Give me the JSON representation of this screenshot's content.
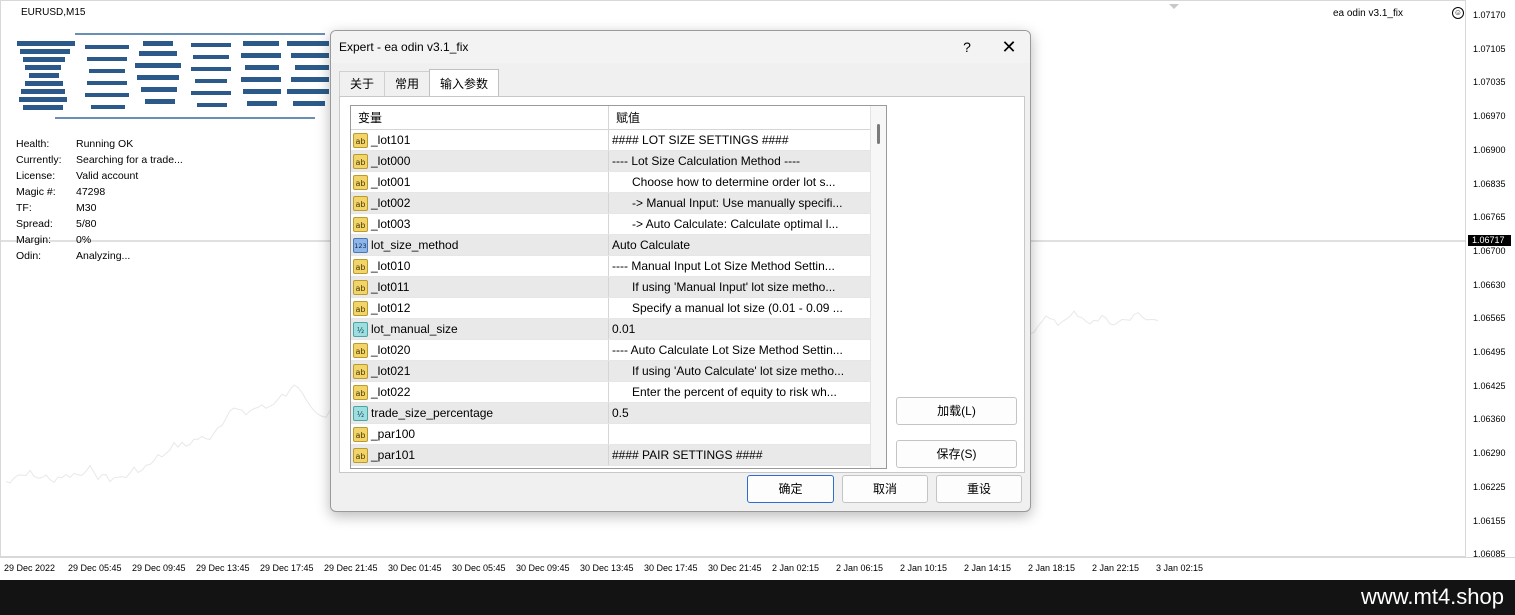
{
  "chart": {
    "symbol": "EURUSD,M15",
    "ea_label": "ea odin v3.1_fix",
    "status": [
      {
        "label": "Health:",
        "value": "Running OK"
      },
      {
        "label": "Currently:",
        "value": "Searching for a trade..."
      },
      {
        "label": "License:",
        "value": "Valid account"
      },
      {
        "label": "Magic #:",
        "value": "47298"
      },
      {
        "label": "TF:",
        "value": "M30"
      },
      {
        "label": "Spread:",
        "value": "5/80"
      },
      {
        "label": "Margin:",
        "value": "0%"
      },
      {
        "label": "Odin:",
        "value": "Analyzing..."
      }
    ],
    "price_labels": [
      "1.07170",
      "1.07105",
      "1.07035",
      "1.06970",
      "1.06900",
      "1.06835",
      "1.06765",
      "1.06700",
      "1.06630",
      "1.06565",
      "1.06495",
      "1.06425",
      "1.06360",
      "1.06290",
      "1.06225",
      "1.06155",
      "1.06085"
    ],
    "current_price": "1.06717",
    "time_labels": [
      "29 Dec 2022",
      "29 Dec 05:45",
      "29 Dec 09:45",
      "29 Dec 13:45",
      "29 Dec 17:45",
      "29 Dec 21:45",
      "30 Dec 01:45",
      "30 Dec 05:45",
      "30 Dec 09:45",
      "30 Dec 13:45",
      "30 Dec 17:45",
      "30 Dec 21:45",
      "2 Jan 02:15",
      "2 Jan 06:15",
      "2 Jan 10:15",
      "2 Jan 14:15",
      "2 Jan 18:15",
      "2 Jan 22:15",
      "3 Jan 02:15"
    ],
    "colors": {
      "line": "#e8e8e8",
      "price_line": "#c0c0c0"
    }
  },
  "dialog": {
    "title": "Expert - ea odin v3.1_fix",
    "help": "?",
    "close": "✕",
    "tabs": [
      "关于",
      "常用",
      "输入参数"
    ],
    "active_tab": 2,
    "grid": {
      "col_var": "变量",
      "col_val": "赋值",
      "rows": [
        {
          "icon": "ab",
          "name": "_lot101",
          "value": "#### LOT SIZE SETTINGS ####"
        },
        {
          "icon": "ab",
          "name": "_lot000",
          "value": "---- Lot Size Calculation Method ----"
        },
        {
          "icon": "ab",
          "name": "_lot001",
          "value": "      Choose how to determine order lot s..."
        },
        {
          "icon": "ab",
          "name": "_lot002",
          "value": "      -> Manual Input: Use manually specifi..."
        },
        {
          "icon": "ab",
          "name": "_lot003",
          "value": "      -> Auto Calculate: Calculate optimal l..."
        },
        {
          "icon": "123",
          "name": "lot_size_method",
          "value": "Auto Calculate"
        },
        {
          "icon": "ab",
          "name": "_lot010",
          "value": "---- Manual Input Lot Size Method Settin..."
        },
        {
          "icon": "ab",
          "name": "_lot011",
          "value": "      If using 'Manual Input' lot size metho..."
        },
        {
          "icon": "ab",
          "name": "_lot012",
          "value": "      Specify a manual lot size (0.01 - 0.09 ..."
        },
        {
          "icon": "half",
          "name": "lot_manual_size",
          "value": "0.01"
        },
        {
          "icon": "ab",
          "name": "_lot020",
          "value": "---- Auto Calculate Lot Size Method Settin..."
        },
        {
          "icon": "ab",
          "name": "_lot021",
          "value": "      If using 'Auto Calculate' lot size metho..."
        },
        {
          "icon": "ab",
          "name": "_lot022",
          "value": "      Enter the percent of equity to risk wh..."
        },
        {
          "icon": "half",
          "name": "trade_size_percentage",
          "value": "0.5"
        },
        {
          "icon": "ab",
          "name": "_par100",
          "value": ""
        },
        {
          "icon": "ab",
          "name": "_par101",
          "value": "#### PAIR SETTINGS ####"
        }
      ]
    },
    "buttons": {
      "load": "加载(L)",
      "save": "保存(S)",
      "ok": "确定",
      "cancel": "取消",
      "reset": "重设"
    }
  },
  "icons": {
    "ab": "ab",
    "123": "123",
    "half": "½"
  },
  "footer": {
    "text": "www.mt4.shop"
  }
}
